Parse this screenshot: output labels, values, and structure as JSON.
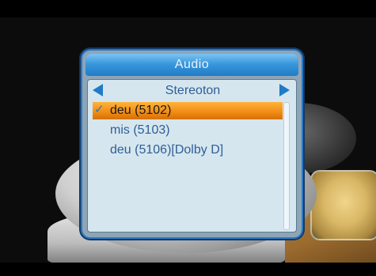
{
  "menu": {
    "title": "Audio",
    "mode_label": "Stereoton",
    "tracks": [
      {
        "label": "deu (5102)",
        "selected": true
      },
      {
        "label": "mis (5103)",
        "selected": false
      },
      {
        "label": "deu (5106)[Dolby D]",
        "selected": false
      }
    ],
    "check_glyph": "✓"
  },
  "icons": {
    "left_arrow": "arrow-left-icon",
    "right_arrow": "arrow-right-icon",
    "check": "check-icon"
  },
  "colors": {
    "accent_blue": "#2c78c4",
    "selection_orange": "#f08b14",
    "list_text": "#2d5f96"
  }
}
